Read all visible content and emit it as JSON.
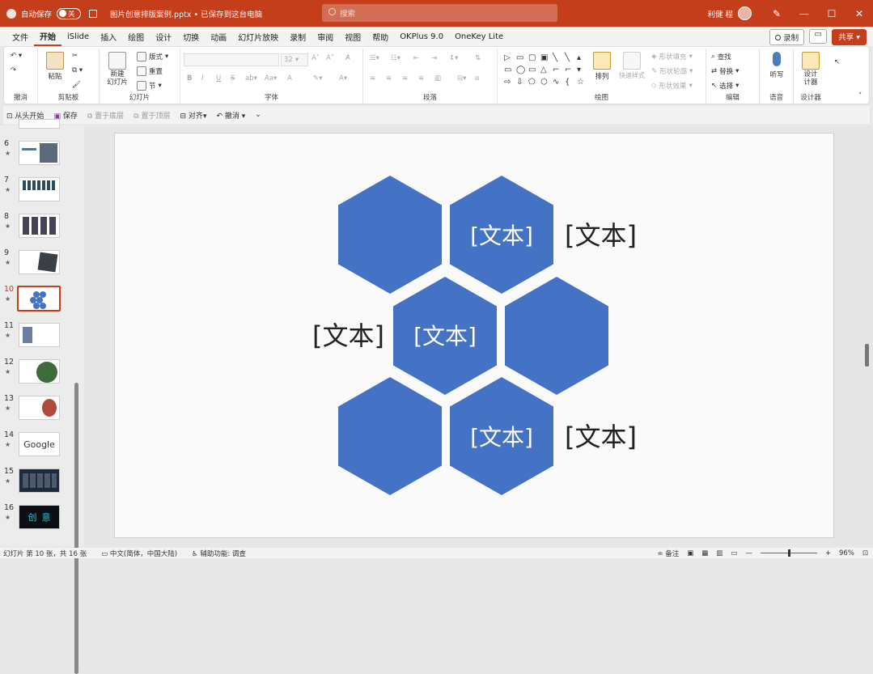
{
  "titlebar": {
    "autosave_label": "自动保存",
    "autosave_state": "关",
    "doc_title": "图片创意排版案例.pptx • 已保存到这台电脑",
    "search_placeholder": "搜索",
    "user_name": "利健 程"
  },
  "menubar": {
    "tabs": [
      "文件",
      "开始",
      "iSlide",
      "插入",
      "绘图",
      "设计",
      "切换",
      "动画",
      "幻灯片放映",
      "录制",
      "审阅",
      "视图",
      "帮助",
      "OKPlus 9.0",
      "OneKey Lite"
    ],
    "active_tab": "开始",
    "record_label": "录制",
    "share_label": "共享"
  },
  "ribbon": {
    "undo_group": "撤消",
    "clipboard": {
      "paste": "粘贴",
      "label": "剪贴板"
    },
    "slides": {
      "new_slide": "新建\n幻灯片",
      "layout": "版式",
      "reset": "重置",
      "section": "节",
      "label": "幻灯片"
    },
    "font": {
      "size": "32",
      "label": "字体"
    },
    "paragraph": {
      "label": "段落"
    },
    "drawing": {
      "arrange": "排列",
      "quick_styles": "快速样式",
      "shape_fill": "形状填充",
      "shape_outline": "形状轮廓",
      "shape_effects": "形状效果",
      "label": "绘图"
    },
    "editing": {
      "find": "查找",
      "replace": "替换",
      "select": "选择",
      "label": "编辑"
    },
    "voice": {
      "dictate": "听写",
      "label": "语音"
    },
    "designer": {
      "button": "设计\n计器",
      "label": "设计器"
    }
  },
  "qat": {
    "from_start": "从头开始",
    "save": "保存",
    "send_back": "置于底层",
    "bring_front": "置于顶层",
    "align": "对齐",
    "undo": "撤消"
  },
  "thumbnails": [
    {
      "num": "6",
      "star": "★"
    },
    {
      "num": "7",
      "star": "★"
    },
    {
      "num": "8",
      "star": "★"
    },
    {
      "num": "9",
      "star": "★"
    },
    {
      "num": "10",
      "star": "★"
    },
    {
      "num": "11",
      "star": "★"
    },
    {
      "num": "12",
      "star": "★"
    },
    {
      "num": "13",
      "star": "★"
    },
    {
      "num": "14",
      "star": "★"
    },
    {
      "num": "15",
      "star": "★"
    },
    {
      "num": "16",
      "star": "★"
    }
  ],
  "thumb_texts": {
    "google": "Google",
    "chuang": "创",
    "yi": "意"
  },
  "active_slide": "10",
  "slide": {
    "hex_color": "#4472c4",
    "hex_labels": [
      "[文本]",
      "[文本]",
      "[文本]"
    ],
    "side_labels": [
      "[文本]",
      "[文本]",
      "[文本]"
    ]
  },
  "statusbar": {
    "slide_info": "幻灯片 第 10 张，共 16 张",
    "language": "中文(简体，中国大陆)",
    "accessibility": "辅助功能: 调查",
    "notes": "备注",
    "zoom": "96%"
  }
}
